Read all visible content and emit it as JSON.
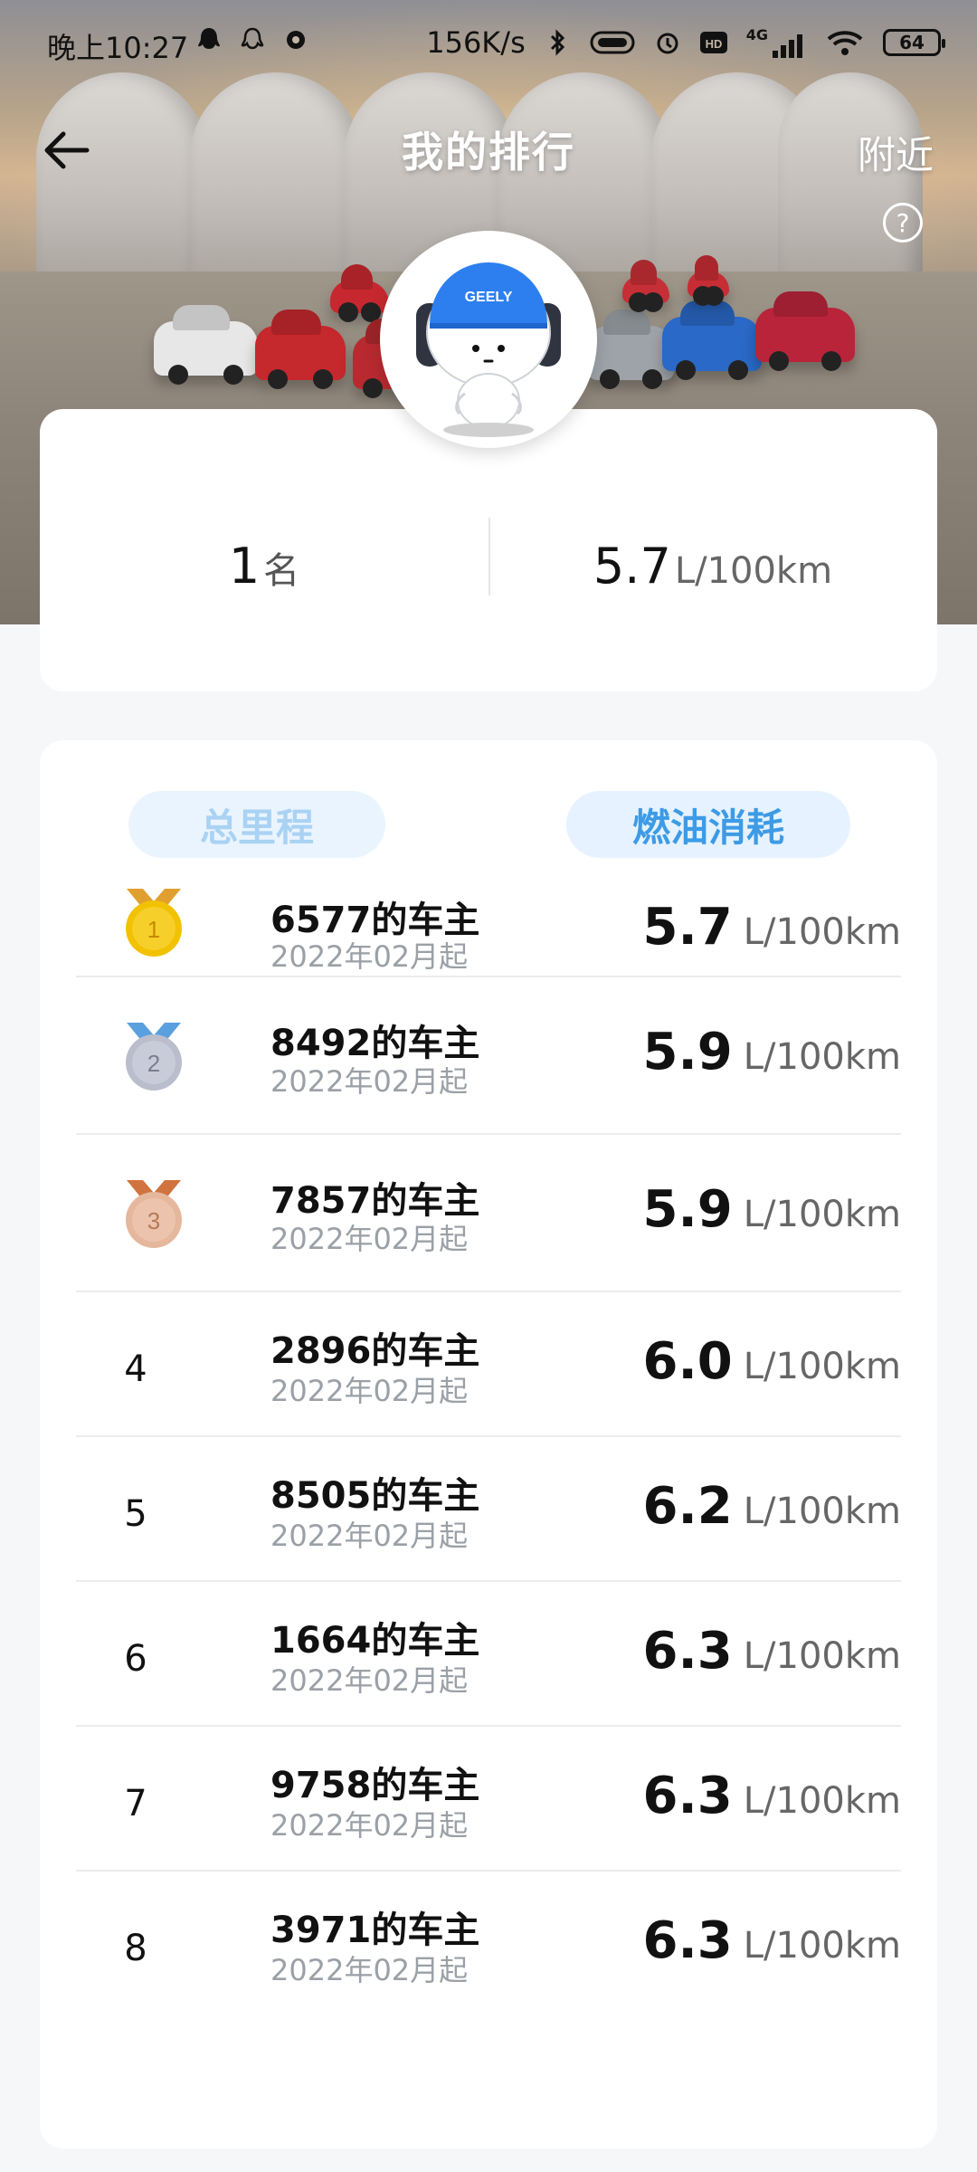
{
  "status_bar": {
    "time": "晚上10:27",
    "net_speed": "156K/s",
    "network": "4G",
    "battery": "64"
  },
  "header": {
    "title": "我的排行",
    "nearby": "附近",
    "help": "?"
  },
  "avatar": {
    "logo_text": "GEELY"
  },
  "summary": {
    "rank_value": "1",
    "rank_unit": "名",
    "fuel_value": "5.7",
    "fuel_unit": "L/100km"
  },
  "tabs": [
    {
      "label": "总里程",
      "active": false
    },
    {
      "label": "燃油消耗",
      "active": true
    }
  ],
  "list": [
    {
      "rank": "1",
      "owner": "6577的车主",
      "since": "2022年02月起",
      "value": "5.7",
      "unit": "L/100km"
    },
    {
      "rank": "2",
      "owner": "8492的车主",
      "since": "2022年02月起",
      "value": "5.9",
      "unit": "L/100km"
    },
    {
      "rank": "3",
      "owner": "7857的车主",
      "since": "2022年02月起",
      "value": "5.9",
      "unit": "L/100km"
    },
    {
      "rank": "4",
      "owner": "2896的车主",
      "since": "2022年02月起",
      "value": "6.0",
      "unit": "L/100km"
    },
    {
      "rank": "5",
      "owner": "8505的车主",
      "since": "2022年02月起",
      "value": "6.2",
      "unit": "L/100km"
    },
    {
      "rank": "6",
      "owner": "1664的车主",
      "since": "2022年02月起",
      "value": "6.3",
      "unit": "L/100km"
    },
    {
      "rank": "7",
      "owner": "9758的车主",
      "since": "2022年02月起",
      "value": "6.3",
      "unit": "L/100km"
    },
    {
      "rank": "8",
      "owner": "3971的车主",
      "since": "2022年02月起",
      "value": "6.3",
      "unit": "L/100km"
    }
  ],
  "colors": {
    "accent": "#3d9be6",
    "tab_active_bg": "#e6f2ff",
    "tab_inactive_text": "#a9d2f3",
    "gold": "#f2c200",
    "silver": "#b9bdcc",
    "bronze": "#e5b79d"
  }
}
